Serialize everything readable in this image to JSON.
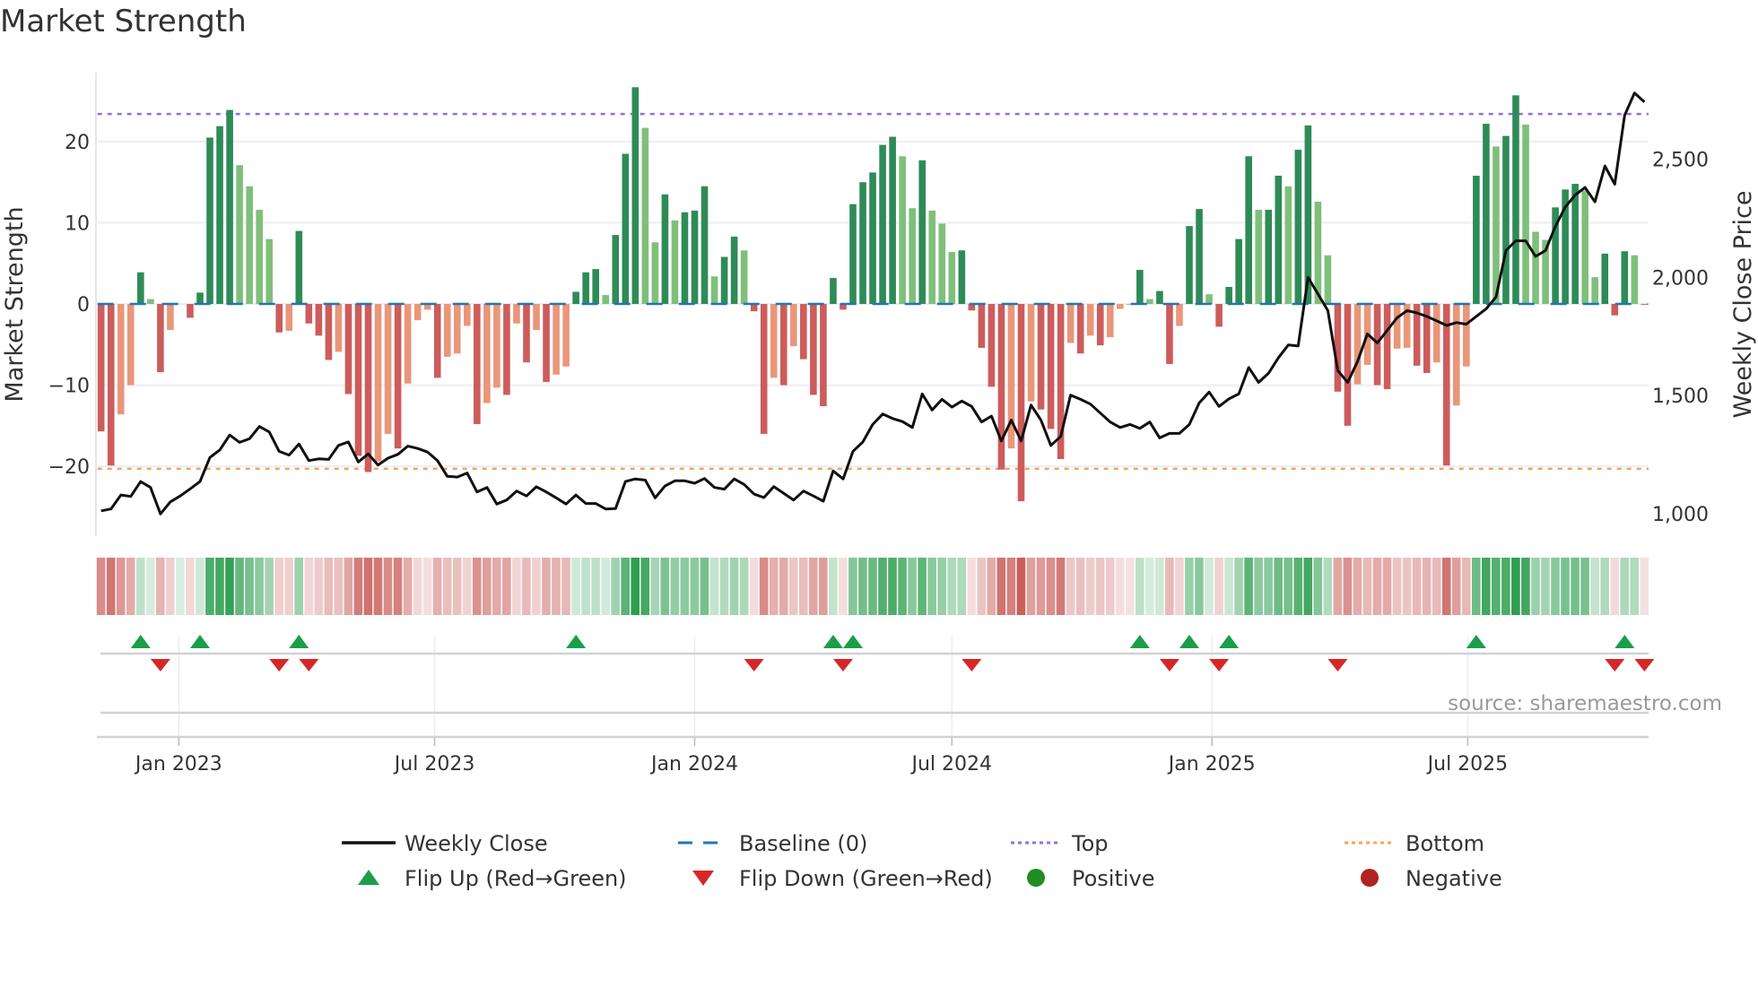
{
  "title": "Market Strength",
  "source": "source: sharemaestro.com",
  "colors": {
    "strong_green": "#2e8b57",
    "weak_green": "#7fbf7b",
    "strong_red": "#cd5c5c",
    "weak_red": "#e9967a",
    "close": "#111111",
    "baseline": "#1f77b4",
    "top": "#9370db",
    "bottom": "#f4a460",
    "flip_up": "#1a9e4a",
    "flip_down": "#d62728",
    "positive": "#228b22",
    "negative": "#b22222"
  },
  "legend": [
    {
      "label": "Weekly Close",
      "kind": "line",
      "key": "close"
    },
    {
      "label": "Baseline (0)",
      "kind": "dash",
      "key": "baseline"
    },
    {
      "label": "Top",
      "kind": "dot",
      "key": "top"
    },
    {
      "label": "Bottom",
      "kind": "dot",
      "key": "bottom"
    },
    {
      "label": "Flip Up (Red→Green)",
      "kind": "up",
      "key": "flip_up"
    },
    {
      "label": "Flip Down (Green→Red)",
      "kind": "down",
      "key": "flip_down"
    },
    {
      "label": "Positive",
      "kind": "circle",
      "key": "positive"
    },
    {
      "label": "Negative",
      "kind": "circle",
      "key": "negative"
    }
  ],
  "chart_data": {
    "type": "bar",
    "title": "Market Strength",
    "ylabel": "Market Strength",
    "y2label": "Weekly Close Price",
    "ylim": [
      -28.6,
      28.5
    ],
    "y2lim": [
      905,
      2867
    ],
    "yticks": [
      20,
      10,
      0,
      -10,
      -20
    ],
    "ytick_labels": [
      "20",
      "10",
      "0",
      "−10",
      "−20"
    ],
    "y2ticks": [
      2500,
      2000,
      1500,
      1000
    ],
    "y2tick_labels": [
      "2,500",
      "2,000",
      "1,500",
      "1,000"
    ],
    "xticks": [
      {
        "date": "2023-01-01",
        "label": "Jan 2023"
      },
      {
        "date": "2023-07-01",
        "label": "Jul 2023"
      },
      {
        "date": "2024-01-01",
        "label": "Jan 2024"
      },
      {
        "date": "2024-07-01",
        "label": "Jul 2024"
      },
      {
        "date": "2025-01-01",
        "label": "Jan 2025"
      },
      {
        "date": "2025-07-01",
        "label": "Jul 2025"
      }
    ],
    "start_date": "2022-11-07",
    "interval_days": 7,
    "top_level": 23.4,
    "bottom_level": -20.3,
    "strength": [
      -15.7,
      -19.9,
      -13.6,
      -10.0,
      3.9,
      0.6,
      -8.4,
      -3.2,
      0,
      -1.7,
      1.4,
      20.5,
      21.9,
      23.9,
      17.1,
      14.5,
      11.6,
      8.0,
      -3.5,
      -3.3,
      9.0,
      -2.4,
      -3.9,
      -6.9,
      -5.9,
      -11.1,
      -18.7,
      -20.7,
      -19.4,
      -16.0,
      -17.8,
      -9.8,
      -2.0,
      -0.7,
      -9.1,
      -6.5,
      -6.1,
      -2.7,
      -14.8,
      -12.2,
      -10.3,
      -11.2,
      -2.4,
      -7.2,
      -3.2,
      -9.6,
      -8.7,
      -7.7,
      1.5,
      3.9,
      4.3,
      1.1,
      8.5,
      18.5,
      26.7,
      21.7,
      7.6,
      13.5,
      10.3,
      11.3,
      11.5,
      14.5,
      3.4,
      5.8,
      8.3,
      6.6,
      -0.9,
      -16.0,
      -9.1,
      -10.0,
      -5.2,
      -6.8,
      -11.2,
      -12.6,
      3.2,
      -0.7,
      12.3,
      15.0,
      16.2,
      19.6,
      20.6,
      18.2,
      11.8,
      17.7,
      11.5,
      9.9,
      6.4,
      6.6,
      -0.8,
      -5.4,
      -10.2,
      -20.4,
      -17.8,
      -24.3,
      -12.0,
      -13.0,
      -15.4,
      -19.1,
      -4.8,
      -6.1,
      -3.9,
      -5.1,
      -4.1,
      -0.6,
      -0.1,
      4.2,
      0.6,
      1.6,
      -7.4,
      -2.7,
      9.6,
      11.7,
      1.2,
      -2.8,
      2.1,
      8.0,
      18.2,
      11.6,
      11.6,
      15.8,
      14.5,
      19.0,
      22.0,
      12.6,
      6.0,
      -10.8,
      -15.0,
      -9.9,
      -7.5,
      -10.0,
      -10.5,
      -5.5,
      -5.4,
      -7.6,
      -8.5,
      -7.2,
      -19.9,
      -12.5,
      -7.7,
      15.8,
      22.2,
      19.4,
      20.7,
      25.7,
      22.1,
      8.9,
      7.9,
      11.9,
      14.1,
      14.8,
      14.0,
      3.3,
      6.2,
      -1.4,
      6.5,
      6.0,
      -0.1
    ],
    "strength_class": "RRrrGgRrrRGGGGggggRrGRRRrRRRrrRrrrRrrrRrrRrRrRrrGGGgGGGggGgGGGgGGgRRrRrRRRGRGGGGGggGgggGRRRRrRrRRRrRrRrrrGgGRrGGgRGGGgGGgGGggRRrrRRrrRRrRrrGGgGGgggGGGggGRGgR",
    "weekly_close": [
      1012,
      1020,
      1079,
      1073,
      1136,
      1111,
      999,
      1050,
      1075,
      1105,
      1136,
      1238,
      1270,
      1333,
      1302,
      1317,
      1369,
      1346,
      1264,
      1248,
      1295,
      1225,
      1232,
      1230,
      1289,
      1304,
      1219,
      1253,
      1206,
      1235,
      1251,
      1286,
      1276,
      1261,
      1225,
      1158,
      1155,
      1172,
      1092,
      1111,
      1041,
      1058,
      1096,
      1075,
      1114,
      1092,
      1067,
      1041,
      1079,
      1043,
      1043,
      1020,
      1022,
      1136,
      1147,
      1142,
      1067,
      1117,
      1139,
      1139,
      1129,
      1149,
      1111,
      1104,
      1147,
      1124,
      1083,
      1068,
      1115,
      1086,
      1058,
      1096,
      1075,
      1053,
      1181,
      1147,
      1264,
      1304,
      1378,
      1422,
      1403,
      1390,
      1365,
      1507,
      1439,
      1484,
      1451,
      1477,
      1454,
      1388,
      1413,
      1308,
      1396,
      1308,
      1460,
      1397,
      1289,
      1327,
      1502,
      1484,
      1464,
      1426,
      1388,
      1365,
      1378,
      1361,
      1388,
      1321,
      1340,
      1340,
      1378,
      1469,
      1515,
      1454,
      1486,
      1507,
      1619,
      1556,
      1594,
      1660,
      1714,
      1710,
      2000,
      1930,
      1860,
      1606,
      1556,
      1644,
      1761,
      1723,
      1776,
      1829,
      1860,
      1850,
      1835,
      1816,
      1797,
      1809,
      1802,
      1835,
      1867,
      1917,
      2114,
      2155,
      2155,
      2089,
      2114,
      2216,
      2298,
      2349,
      2381,
      2320,
      2472,
      2394,
      2686,
      2781,
      2743
    ],
    "flip_up_weeks": [
      4,
      10,
      20,
      48,
      74,
      76,
      105,
      110,
      114,
      139,
      154
    ],
    "flip_down_weeks": [
      6,
      18,
      21,
      66,
      75,
      88,
      108,
      113,
      125,
      153,
      156
    ],
    "legend_position": "bottom"
  }
}
